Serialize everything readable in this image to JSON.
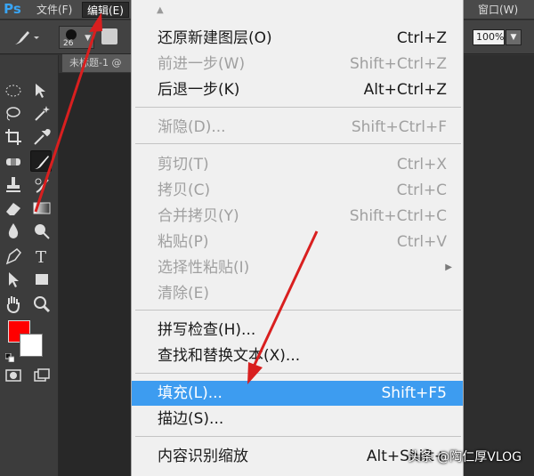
{
  "app": {
    "logo": "Ps"
  },
  "menubar": {
    "file": "文件(F)",
    "edit": "编辑(E)",
    "window": "窗口(W)"
  },
  "options": {
    "brush_size": "26",
    "zoom": "100%"
  },
  "document": {
    "tab_title": "未标题-1 @"
  },
  "colors": {
    "foreground": "#ff0000",
    "background": "#ffffff",
    "highlight": "#3d9cf0"
  },
  "edit_menu": {
    "items": [
      {
        "label": "还原新建图层(O)",
        "shortcut": "Ctrl+Z",
        "enabled": true
      },
      {
        "label": "前进一步(W)",
        "shortcut": "Shift+Ctrl+Z",
        "enabled": false
      },
      {
        "label": "后退一步(K)",
        "shortcut": "Alt+Ctrl+Z",
        "enabled": true
      },
      {
        "label": "渐隐(D)...",
        "shortcut": "Shift+Ctrl+F",
        "enabled": false
      },
      {
        "label": "剪切(T)",
        "shortcut": "Ctrl+X",
        "enabled": false
      },
      {
        "label": "拷贝(C)",
        "shortcut": "Ctrl+C",
        "enabled": false
      },
      {
        "label": "合并拷贝(Y)",
        "shortcut": "Shift+Ctrl+C",
        "enabled": false
      },
      {
        "label": "粘贴(P)",
        "shortcut": "Ctrl+V",
        "enabled": false
      },
      {
        "label": "选择性粘贴(I)",
        "shortcut": "",
        "enabled": false,
        "submenu": true
      },
      {
        "label": "清除(E)",
        "shortcut": "",
        "enabled": false
      },
      {
        "label": "拼写检查(H)...",
        "shortcut": "",
        "enabled": true
      },
      {
        "label": "查找和替换文本(X)...",
        "shortcut": "",
        "enabled": true
      },
      {
        "label": "填充(L)...",
        "shortcut": "Shift+F5",
        "enabled": true,
        "highlighted": true
      },
      {
        "label": "描边(S)...",
        "shortcut": "",
        "enabled": true
      },
      {
        "label": "内容识别缩放",
        "shortcut": "Alt+Shift+",
        "enabled": true
      }
    ]
  },
  "watermark": "头条 @陶仁厚VLOG",
  "icons": {
    "tools": [
      "marquee-icon",
      "move-icon",
      "lasso-icon",
      "magic-wand-icon",
      "crop-icon",
      "eyedropper-icon",
      "healing-icon",
      "brush-icon",
      "stamp-icon",
      "history-brush-icon",
      "eraser-icon",
      "gradient-icon",
      "blur-icon",
      "dodge-icon",
      "pen-icon",
      "type-icon",
      "path-select-icon",
      "rectangle-icon",
      "hand-icon",
      "zoom-icon",
      "quick-mask-icon",
      "screen-mode-icon"
    ]
  }
}
